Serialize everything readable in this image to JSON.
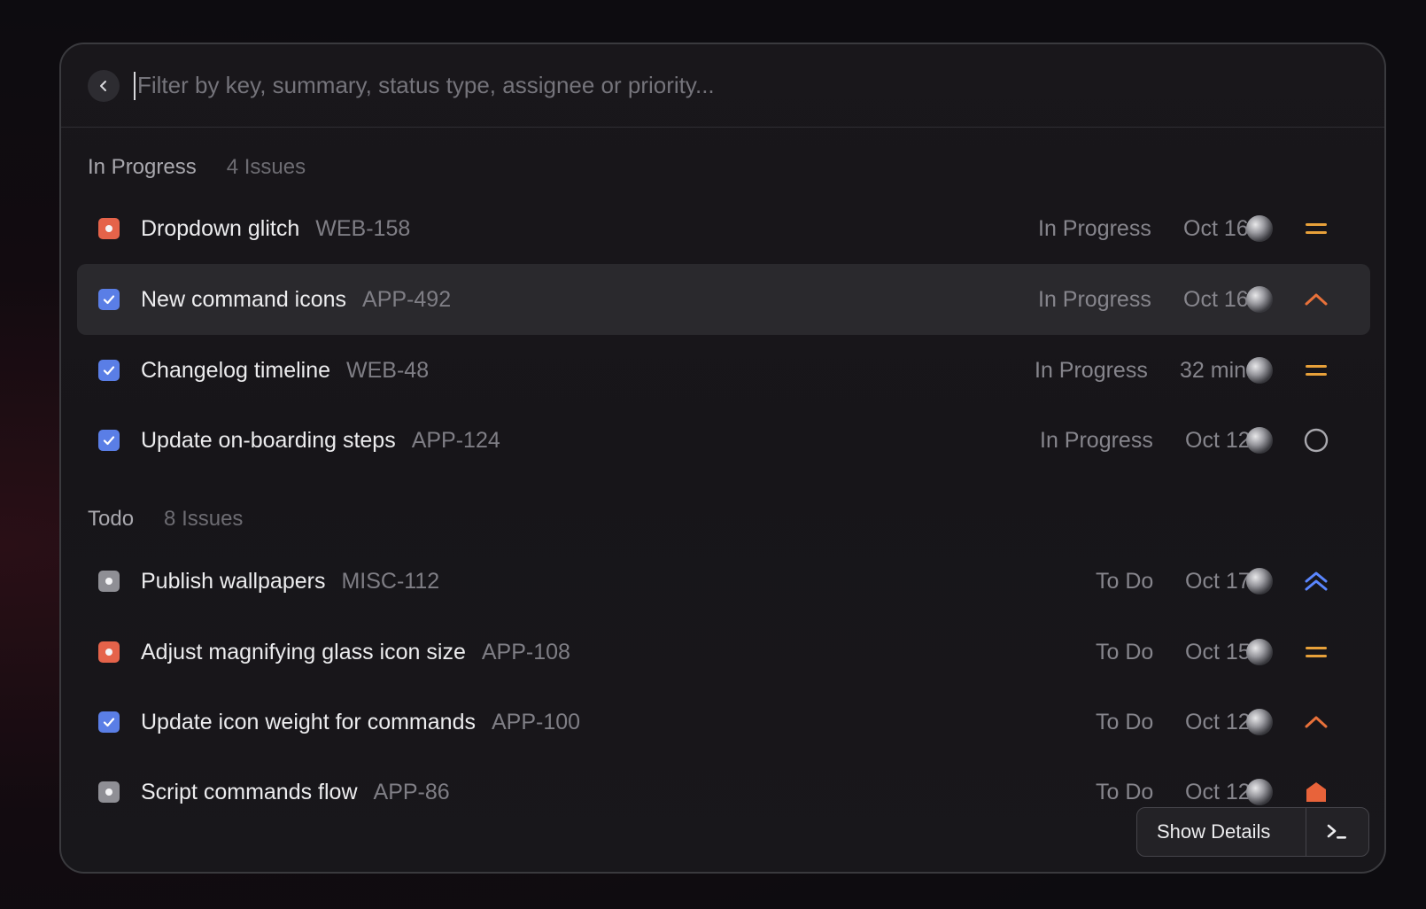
{
  "search": {
    "placeholder": "Filter by key, summary, status type, assignee or priority..."
  },
  "sections": [
    {
      "title": "In Progress",
      "count": "4 Issues",
      "issues": [
        {
          "icon": "red-bug",
          "title": "Dropdown glitch",
          "key": "WEB-158",
          "status": "In Progress",
          "date": "Oct 16",
          "priority": "medium"
        },
        {
          "icon": "blue-check",
          "title": "New command icons",
          "key": "APP-492",
          "status": "In Progress",
          "date": "Oct 16",
          "priority": "high"
        },
        {
          "icon": "blue-check",
          "title": "Changelog timeline",
          "key": "WEB-48",
          "status": "In Progress",
          "date": "32 min",
          "priority": "medium"
        },
        {
          "icon": "blue-check",
          "title": "Update on-boarding steps",
          "key": "APP-124",
          "status": "In Progress",
          "date": "Oct 12",
          "priority": "none"
        }
      ]
    },
    {
      "title": "Todo",
      "count": "8 Issues",
      "issues": [
        {
          "icon": "gray-task",
          "title": "Publish wallpapers",
          "key": "MISC-112",
          "status": "To Do",
          "date": "Oct 17",
          "priority": "highest"
        },
        {
          "icon": "red-bug",
          "title": "Adjust magnifying glass icon size",
          "key": "APP-108",
          "status": "To Do",
          "date": "Oct 15",
          "priority": "medium"
        },
        {
          "icon": "blue-check",
          "title": "Update icon weight for commands",
          "key": "APP-100",
          "status": "To Do",
          "date": "Oct 12",
          "priority": "high"
        },
        {
          "icon": "gray-task",
          "title": "Script commands flow",
          "key": "APP-86",
          "status": "To Do",
          "date": "Oct 12",
          "priority": "urgent"
        }
      ]
    }
  ],
  "footer": {
    "show_details_label": "Show Details",
    "terminal_icon": "terminal-icon"
  },
  "colors": {
    "accent_red": "#e5634a",
    "accent_blue": "#5a7ee6",
    "priority_orange": "#e8833a",
    "priority_blue": "#5a86ff"
  }
}
